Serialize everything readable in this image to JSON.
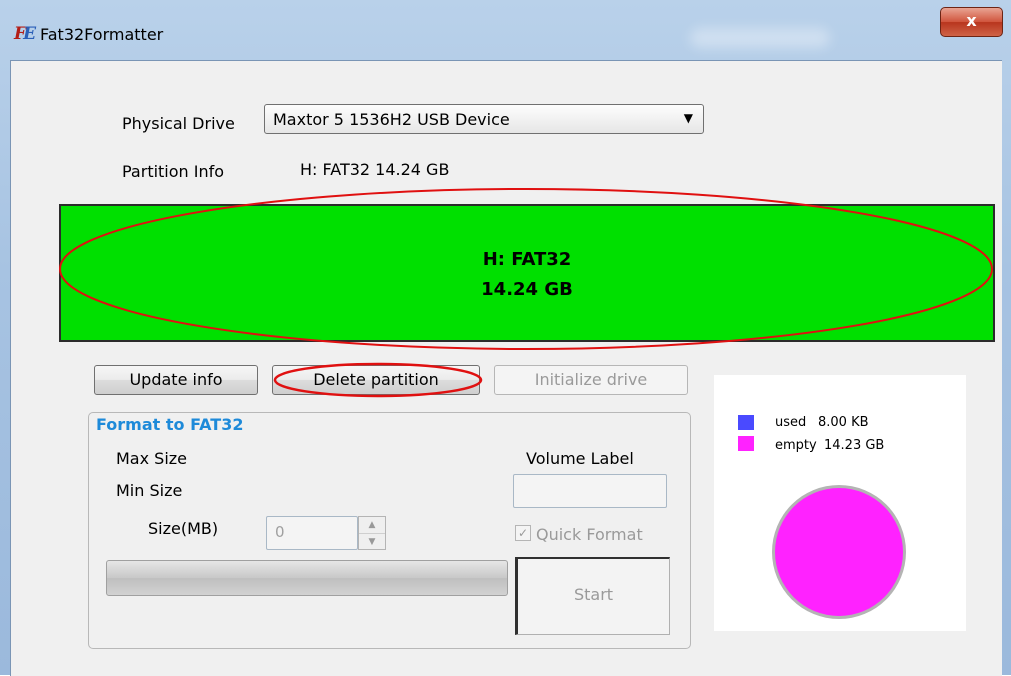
{
  "window": {
    "title": "Fat32Formatter",
    "icon_letters": [
      "F",
      "E"
    ],
    "close_label": "x"
  },
  "drive": {
    "label": "Physical Drive",
    "selected": "Maxtor 5 1536H2 USB Device"
  },
  "partition_info": {
    "label": "Partition Info",
    "value": "H: FAT32  14.24 GB"
  },
  "partition_bar": {
    "line1": "H: FAT32",
    "line2": "14.24 GB",
    "color": "#00e000"
  },
  "buttons": {
    "update_info": "Update info",
    "delete_partition": "Delete partition",
    "initialize_drive": "Initialize drive",
    "start": "Start"
  },
  "format_group": {
    "title": "Format to FAT32",
    "max_size_label": "Max Size",
    "min_size_label": "Min Size",
    "size_label": "Size(MB)",
    "size_value": "0",
    "volume_label_label": "Volume Label",
    "volume_label_value": "",
    "quick_format_label": "Quick Format",
    "quick_format_checked": true
  },
  "usage_chart": {
    "legend": [
      {
        "label": "used",
        "value": "8.00 KB",
        "color": "#4a4aff"
      },
      {
        "label": "empty",
        "value": "14.23 GB",
        "color": "#ff22ff"
      }
    ]
  },
  "chart_data": {
    "type": "pie",
    "slices": [
      {
        "label": "used",
        "value_text": "8.00 KB",
        "value_gb": 7.6e-06
      },
      {
        "label": "empty",
        "value_text": "14.23 GB",
        "value_gb": 14.23
      }
    ]
  },
  "annotation_color": "#e01010"
}
